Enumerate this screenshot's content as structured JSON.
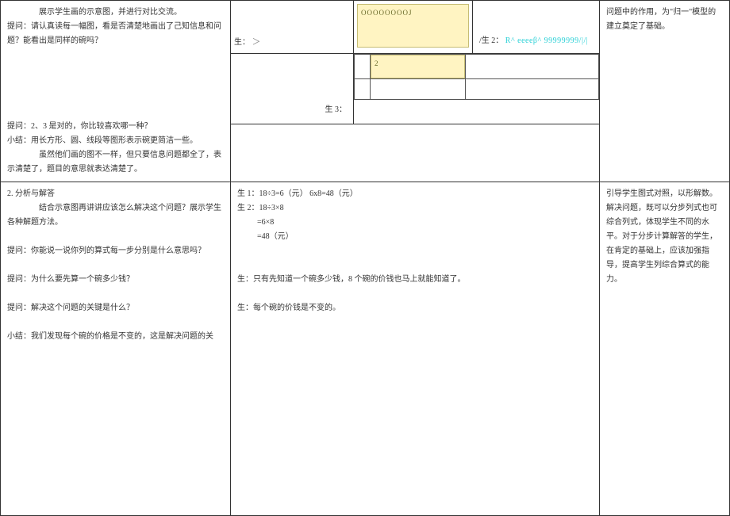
{
  "row1": {
    "left": {
      "l1": "展示学生画的示意图，并进行对比交流。",
      "l2": "提问：请认真读每一幅图，看是否清楚地画出了己知信息和问题？能看出是同样的碗吗？",
      "l3": "提问：2、3 是对的，你比较喜欢哪一种？",
      "l4": "小结：用长方形、圆、线段等图形表示碗更简洁一些。",
      "l5": "虽然他们画的图不一样，但只要信息问题都全了，表示清楚了，题目的意思就表达清楚了。"
    },
    "mid": {
      "ooo": "OOOOOOOOJ",
      "s1_row": "生：",
      "s1_arrow": "＞",
      "s2_label": "/生 2：",
      "s2_deco": "R^ eeeeβ^ 99999999/|/|",
      "s3_label": "生 3：",
      "small_inner_num": "2"
    },
    "right": {
      "r1": "问题中的作用，为\"归一\"模型的建立奠定了基础。"
    }
  },
  "row2": {
    "left": {
      "t1": "2. 分析与解答",
      "t2": "结合示意图再讲讲应该怎么解决这个问题？展示学生各种解题方法。",
      "q1": "提问：你能说一说你列的算式每一步分别是什么意思吗？",
      "q2": "提问：为什么要先算一个碗多少钱？",
      "q3": "提问：解决这个问题的关键是什么？",
      "s1": "小结：我们发现每个碗的价格是不变的，这是解决问题的关"
    },
    "mid": {
      "a1": "生 1：18÷3=6（元）      6x8=48（元）",
      "a2": "生 2：18÷3×8",
      "a3": "          =6×8",
      "a4": "          =48（元）",
      "b1": "生：只有先知道一个碗多少钱，8 个碗的价钱也马上就能知道了。",
      "c1": "生：每个碗的价钱是不变的。"
    },
    "right": {
      "r": "引导学生图式对照，以形解数。解决问题，既可以分步列式也可综合列式，体现学生不同的水平。对于分步计算解答的学生，在肯定的基础上，应该加强指导，提高学生列综合算式的能力。"
    }
  }
}
